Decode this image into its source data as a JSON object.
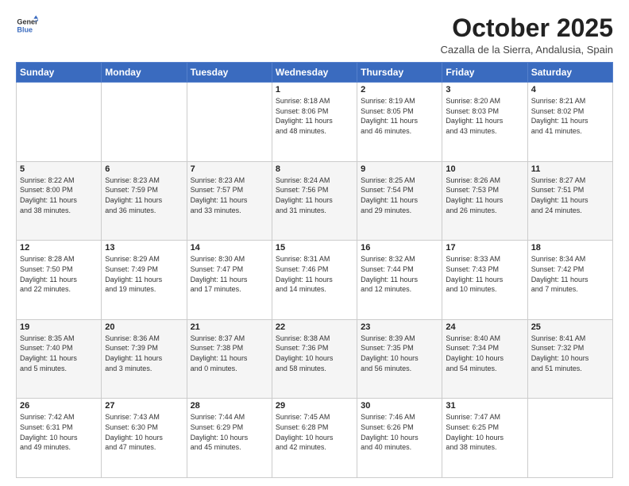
{
  "header": {
    "logo_line1": "General",
    "logo_line2": "Blue",
    "month_title": "October 2025",
    "location": "Cazalla de la Sierra, Andalusia, Spain"
  },
  "weekdays": [
    "Sunday",
    "Monday",
    "Tuesday",
    "Wednesday",
    "Thursday",
    "Friday",
    "Saturday"
  ],
  "weeks": [
    [
      {
        "day": "",
        "info": ""
      },
      {
        "day": "",
        "info": ""
      },
      {
        "day": "",
        "info": ""
      },
      {
        "day": "1",
        "info": "Sunrise: 8:18 AM\nSunset: 8:06 PM\nDaylight: 11 hours\nand 48 minutes."
      },
      {
        "day": "2",
        "info": "Sunrise: 8:19 AM\nSunset: 8:05 PM\nDaylight: 11 hours\nand 46 minutes."
      },
      {
        "day": "3",
        "info": "Sunrise: 8:20 AM\nSunset: 8:03 PM\nDaylight: 11 hours\nand 43 minutes."
      },
      {
        "day": "4",
        "info": "Sunrise: 8:21 AM\nSunset: 8:02 PM\nDaylight: 11 hours\nand 41 minutes."
      }
    ],
    [
      {
        "day": "5",
        "info": "Sunrise: 8:22 AM\nSunset: 8:00 PM\nDaylight: 11 hours\nand 38 minutes."
      },
      {
        "day": "6",
        "info": "Sunrise: 8:23 AM\nSunset: 7:59 PM\nDaylight: 11 hours\nand 36 minutes."
      },
      {
        "day": "7",
        "info": "Sunrise: 8:23 AM\nSunset: 7:57 PM\nDaylight: 11 hours\nand 33 minutes."
      },
      {
        "day": "8",
        "info": "Sunrise: 8:24 AM\nSunset: 7:56 PM\nDaylight: 11 hours\nand 31 minutes."
      },
      {
        "day": "9",
        "info": "Sunrise: 8:25 AM\nSunset: 7:54 PM\nDaylight: 11 hours\nand 29 minutes."
      },
      {
        "day": "10",
        "info": "Sunrise: 8:26 AM\nSunset: 7:53 PM\nDaylight: 11 hours\nand 26 minutes."
      },
      {
        "day": "11",
        "info": "Sunrise: 8:27 AM\nSunset: 7:51 PM\nDaylight: 11 hours\nand 24 minutes."
      }
    ],
    [
      {
        "day": "12",
        "info": "Sunrise: 8:28 AM\nSunset: 7:50 PM\nDaylight: 11 hours\nand 22 minutes."
      },
      {
        "day": "13",
        "info": "Sunrise: 8:29 AM\nSunset: 7:49 PM\nDaylight: 11 hours\nand 19 minutes."
      },
      {
        "day": "14",
        "info": "Sunrise: 8:30 AM\nSunset: 7:47 PM\nDaylight: 11 hours\nand 17 minutes."
      },
      {
        "day": "15",
        "info": "Sunrise: 8:31 AM\nSunset: 7:46 PM\nDaylight: 11 hours\nand 14 minutes."
      },
      {
        "day": "16",
        "info": "Sunrise: 8:32 AM\nSunset: 7:44 PM\nDaylight: 11 hours\nand 12 minutes."
      },
      {
        "day": "17",
        "info": "Sunrise: 8:33 AM\nSunset: 7:43 PM\nDaylight: 11 hours\nand 10 minutes."
      },
      {
        "day": "18",
        "info": "Sunrise: 8:34 AM\nSunset: 7:42 PM\nDaylight: 11 hours\nand 7 minutes."
      }
    ],
    [
      {
        "day": "19",
        "info": "Sunrise: 8:35 AM\nSunset: 7:40 PM\nDaylight: 11 hours\nand 5 minutes."
      },
      {
        "day": "20",
        "info": "Sunrise: 8:36 AM\nSunset: 7:39 PM\nDaylight: 11 hours\nand 3 minutes."
      },
      {
        "day": "21",
        "info": "Sunrise: 8:37 AM\nSunset: 7:38 PM\nDaylight: 11 hours\nand 0 minutes."
      },
      {
        "day": "22",
        "info": "Sunrise: 8:38 AM\nSunset: 7:36 PM\nDaylight: 10 hours\nand 58 minutes."
      },
      {
        "day": "23",
        "info": "Sunrise: 8:39 AM\nSunset: 7:35 PM\nDaylight: 10 hours\nand 56 minutes."
      },
      {
        "day": "24",
        "info": "Sunrise: 8:40 AM\nSunset: 7:34 PM\nDaylight: 10 hours\nand 54 minutes."
      },
      {
        "day": "25",
        "info": "Sunrise: 8:41 AM\nSunset: 7:32 PM\nDaylight: 10 hours\nand 51 minutes."
      }
    ],
    [
      {
        "day": "26",
        "info": "Sunrise: 7:42 AM\nSunset: 6:31 PM\nDaylight: 10 hours\nand 49 minutes."
      },
      {
        "day": "27",
        "info": "Sunrise: 7:43 AM\nSunset: 6:30 PM\nDaylight: 10 hours\nand 47 minutes."
      },
      {
        "day": "28",
        "info": "Sunrise: 7:44 AM\nSunset: 6:29 PM\nDaylight: 10 hours\nand 45 minutes."
      },
      {
        "day": "29",
        "info": "Sunrise: 7:45 AM\nSunset: 6:28 PM\nDaylight: 10 hours\nand 42 minutes."
      },
      {
        "day": "30",
        "info": "Sunrise: 7:46 AM\nSunset: 6:26 PM\nDaylight: 10 hours\nand 40 minutes."
      },
      {
        "day": "31",
        "info": "Sunrise: 7:47 AM\nSunset: 6:25 PM\nDaylight: 10 hours\nand 38 minutes."
      },
      {
        "day": "",
        "info": ""
      }
    ]
  ]
}
